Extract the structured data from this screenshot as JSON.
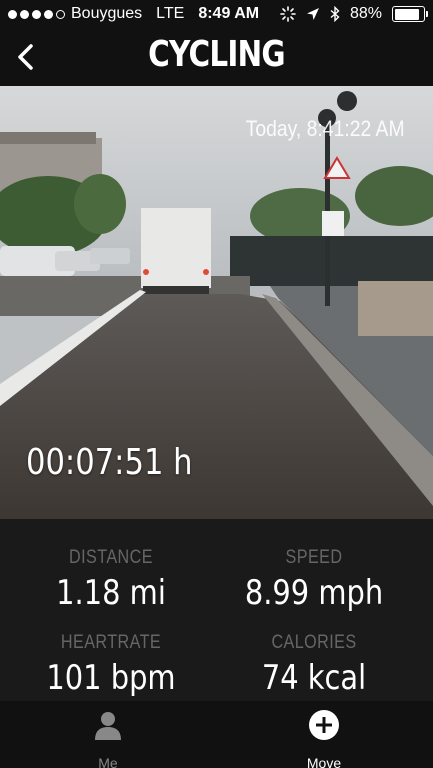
{
  "status_bar": {
    "carrier": "Bouygues",
    "network": "LTE",
    "time": "8:49 AM",
    "battery": "88%",
    "battery_level": 0.88,
    "signal_bars": 4,
    "signal_total": 5
  },
  "nav": {
    "title": "CYCLING",
    "back_icon": "chevron-left-icon"
  },
  "photo": {
    "timestamp": "Today, 8:41:22 AM",
    "duration": "00:07:51 h"
  },
  "stats": {
    "distance": {
      "label": "DISTANCE",
      "value": "1.18 mi"
    },
    "speed": {
      "label": "SPEED",
      "value": "8.99 mph"
    },
    "heartrate": {
      "label": "HEARTRATE",
      "value": "101 bpm"
    },
    "calories": {
      "label": "CALORIES",
      "value": "74 kcal"
    }
  },
  "tabs": [
    {
      "label": "Me",
      "icon": "person-icon",
      "active": false
    },
    {
      "label": "Move",
      "icon": "plus-circle-icon",
      "active": true
    }
  ],
  "colors": {
    "background": "#1a1a1a",
    "bar": "#111111",
    "label_gray": "#666666"
  }
}
